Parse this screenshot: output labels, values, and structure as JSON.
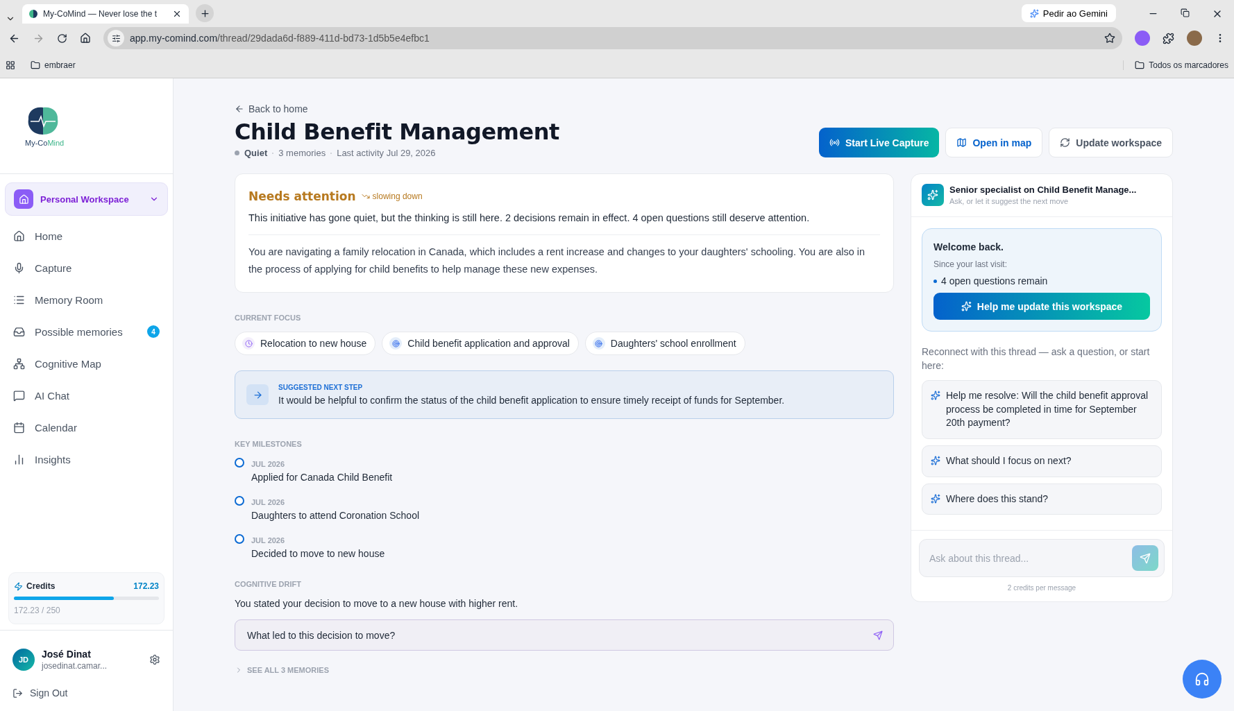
{
  "browser": {
    "tab_title": "My-CoMind — Never lose the t",
    "url_host": "app.my-comind.com",
    "url_path": "/thread/29dada6d-f889-411d-bd73-1d5b5e4efbc1",
    "gemini": "Pedir ao Gemini",
    "bookmark": "embraer",
    "all_bookmarks": "Todos os marcadores"
  },
  "sidebar": {
    "logo_main": "My-Co",
    "logo_accent": "Mind",
    "workspace": "Personal Workspace",
    "items": [
      {
        "label": "Home",
        "selected": false
      },
      {
        "label": "Capture",
        "selected": false
      },
      {
        "label": "Memory Room",
        "selected": false
      },
      {
        "label": "Possible memories",
        "selected": false,
        "badge": "4"
      },
      {
        "label": "Cognitive Map",
        "selected": false
      },
      {
        "label": "AI Chat",
        "selected": false
      },
      {
        "label": "Calendar",
        "selected": false
      },
      {
        "label": "Insights",
        "selected": false
      }
    ],
    "credits": {
      "label": "Credits",
      "value": "172.23",
      "level": 0.69,
      "reading": "172.23 / 250"
    },
    "user": {
      "initials": "JD",
      "name": "José Dinat",
      "email": "josedinat.camar..."
    },
    "sign_out": "Sign Out"
  },
  "header": {
    "back": "Back to home",
    "title": "Child Benefit Management",
    "status": "Quiet",
    "memories": "3 memories",
    "last_activity": "Last activity Jul 29, 2026",
    "buttons": [
      {
        "label": "Start Live Capture",
        "kind": "primary"
      },
      {
        "label": "Open in map",
        "kind": "map"
      },
      {
        "label": "Update workspace",
        "kind": "update"
      }
    ]
  },
  "attention": {
    "heading": "Needs attention",
    "trend": "slowing down",
    "summary": "This initiative has gone quiet, but the thinking is still here. 2 decisions remain in effect. 4 open questions still deserve attention.",
    "description": "You are navigating a family relocation in Canada, which includes a rent increase and changes to your daughters' schooling. You are also in the process of applying for child benefits to help manage these new expenses."
  },
  "focus": {
    "label": "CURRENT FOCUS",
    "chips": [
      {
        "label": "Relocation to new house",
        "kind": "pending"
      },
      {
        "label": "Child benefit application and approval",
        "kind": "target"
      },
      {
        "label": "Daughters' school enrollment",
        "kind": "target"
      }
    ]
  },
  "next_step": {
    "label": "SUGGESTED NEXT STEP",
    "text": "It would be helpful to confirm the status of the child benefit application to ensure timely receipt of funds for September."
  },
  "milestones": {
    "label": "KEY MILESTONES",
    "items": [
      {
        "date": "JUL 2026",
        "title": "Applied for Canada Child Benefit"
      },
      {
        "date": "JUL 2026",
        "title": "Daughters to attend Coronation School"
      },
      {
        "date": "JUL 2026",
        "title": "Decided to move to new house"
      }
    ]
  },
  "drift": {
    "label": "COGNITIVE DRIFT",
    "statement": "You stated your decision to move to a new house with higher rent.",
    "question": "What led to this decision to move?"
  },
  "see_all": "SEE ALL 3 MEMORIES",
  "assistant": {
    "title": "Senior specialist on Child Benefit Manage...",
    "subtitle": "Ask, or let it suggest the next move",
    "welcome": "Welcome back.",
    "since": "Since your last visit:",
    "bullets": [
      "4 open questions remain"
    ],
    "update_button": "Help me update this workspace",
    "reconnect": "Reconnect with this thread — ask a question, or start here:",
    "suggestions": [
      "Help me resolve: Will the child benefit approval process be completed in time for September 20th payment?",
      "What should I focus on next?",
      "Where does this stand?"
    ],
    "placeholder": "Ask about this thread...",
    "note": "2 credits per message"
  }
}
